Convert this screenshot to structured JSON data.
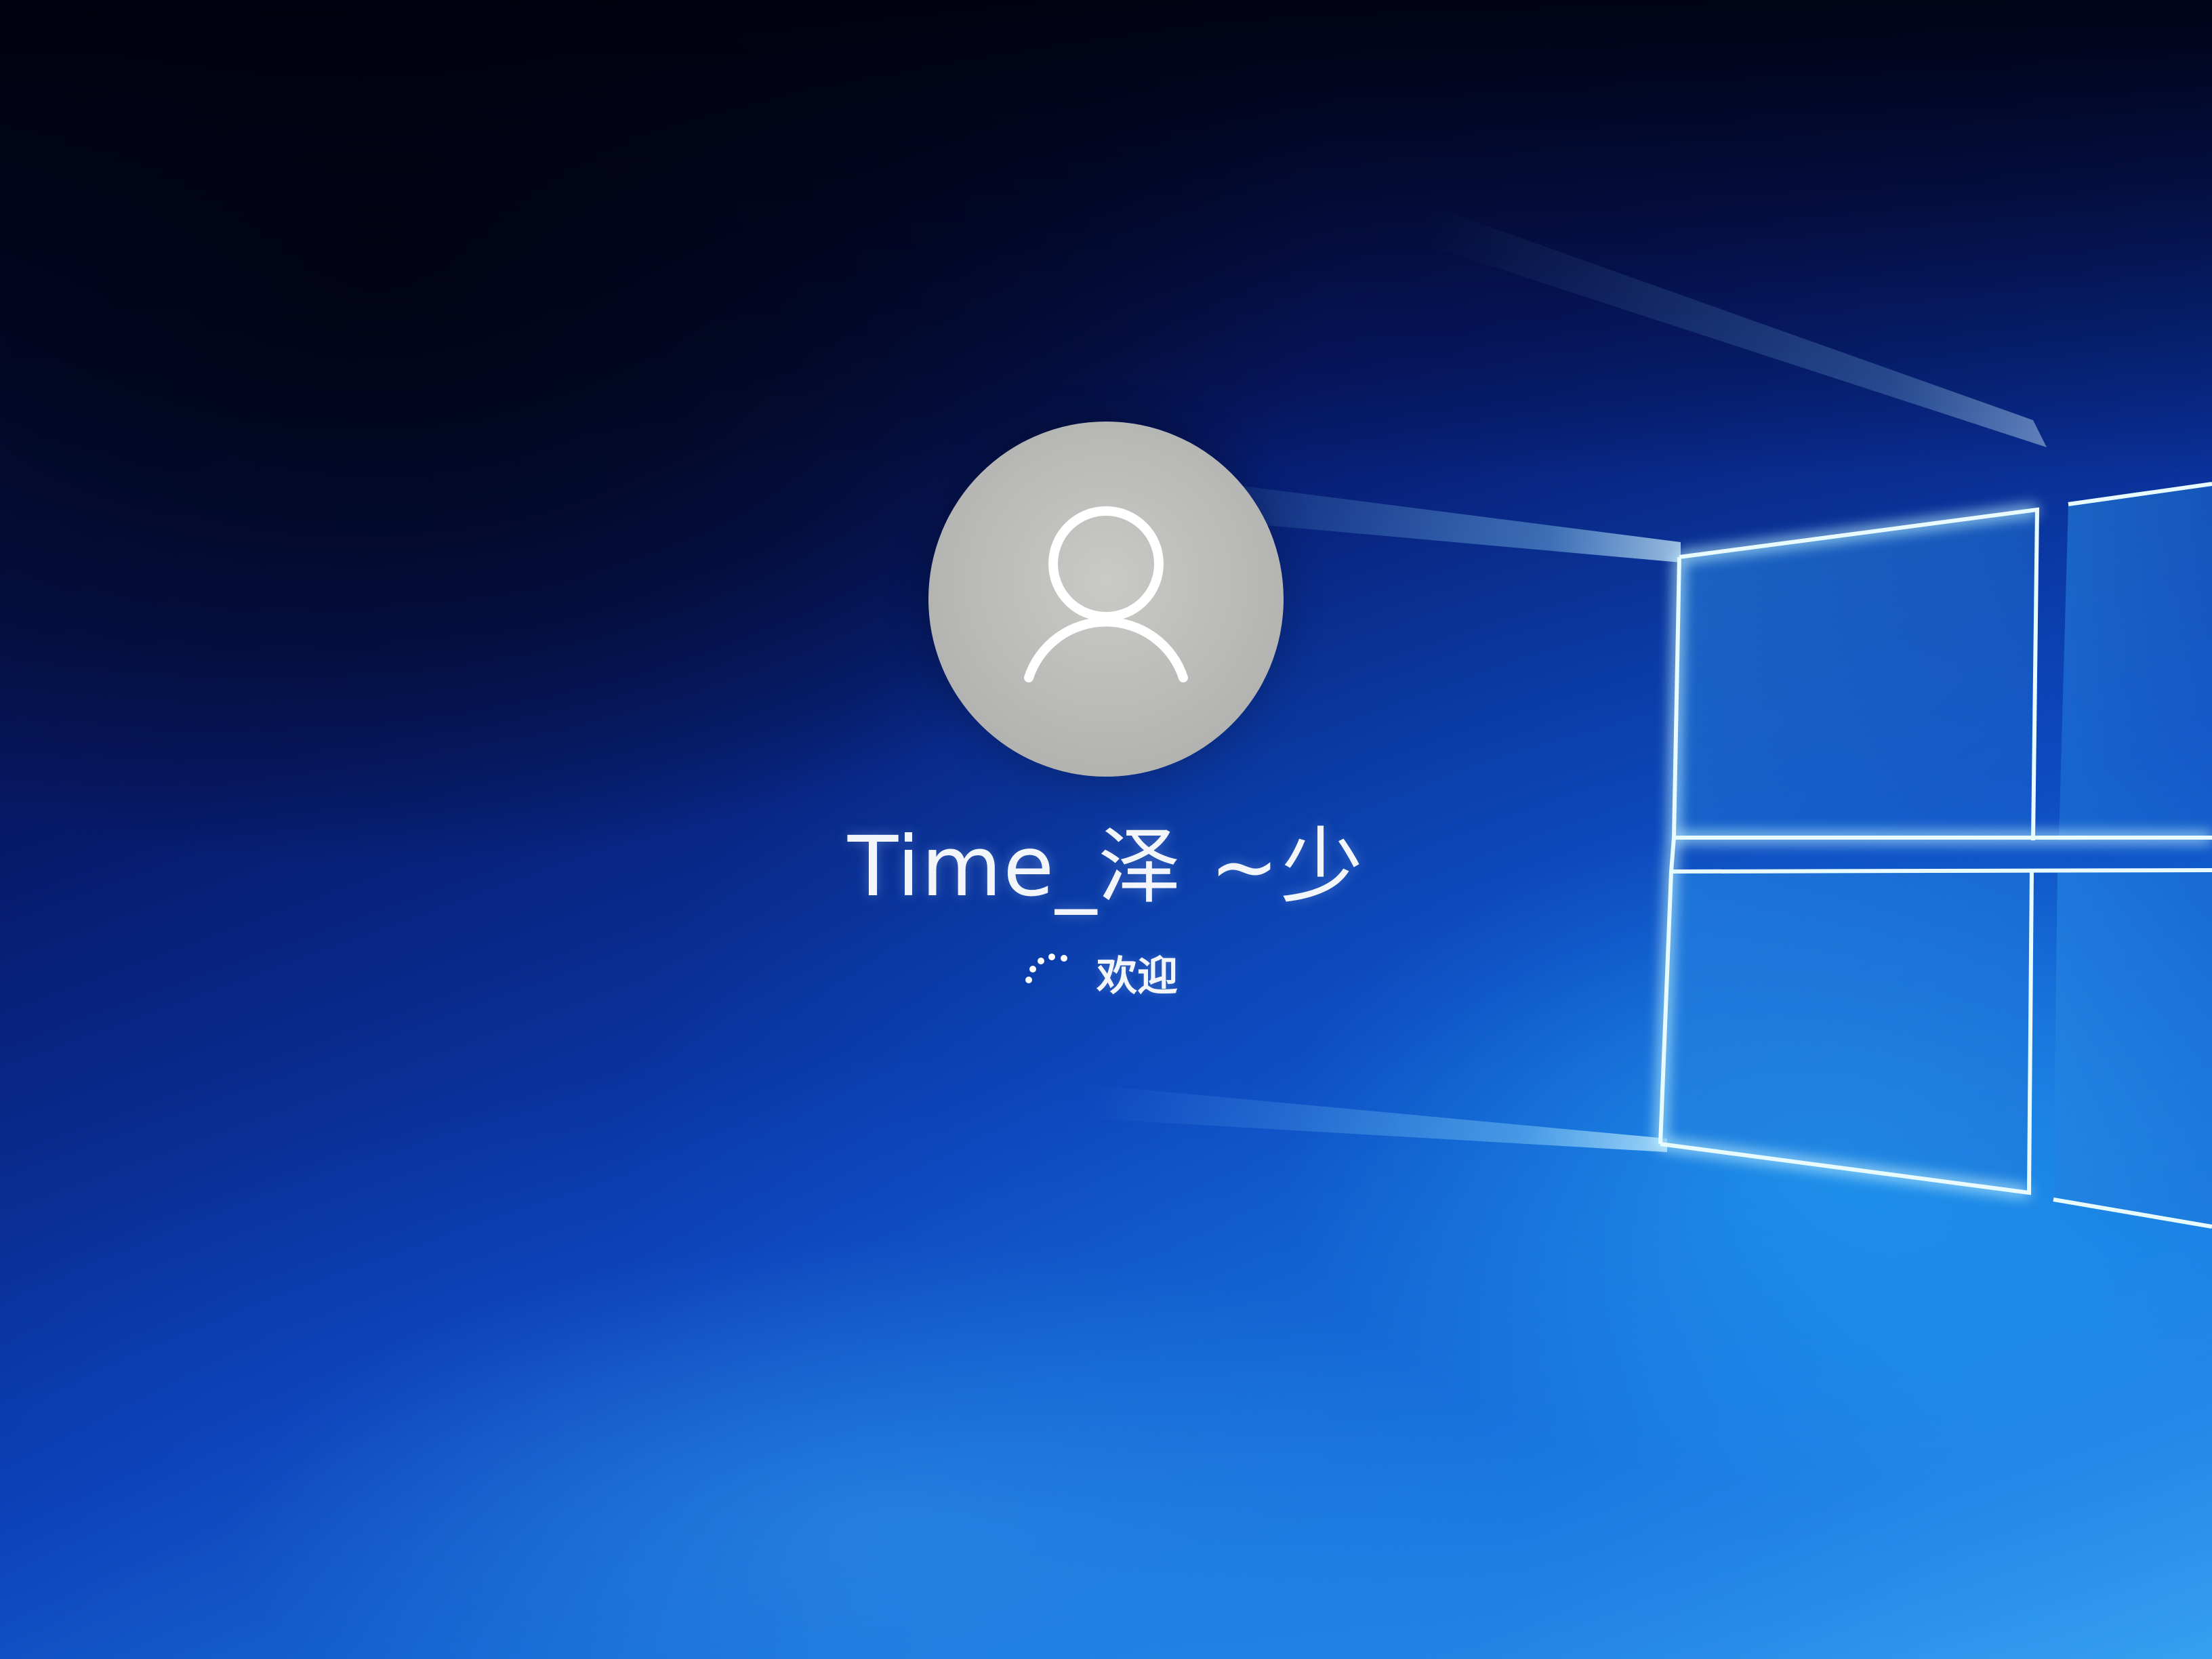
{
  "login": {
    "username": "Time_泽 ~少",
    "status": "欢迎",
    "avatar_icon": "user-silhouette-icon",
    "spinner_icon": "loading-spinner-icon"
  },
  "colors": {
    "background_dark": "#03061d",
    "background_blue": "#0b3fb8",
    "background_light": "#3aa5f2",
    "avatar_fill": "#b8b9b6",
    "avatar_icon": "#ffffff",
    "text": "#f2f5fa",
    "window_glow": "#7fe3ff"
  }
}
